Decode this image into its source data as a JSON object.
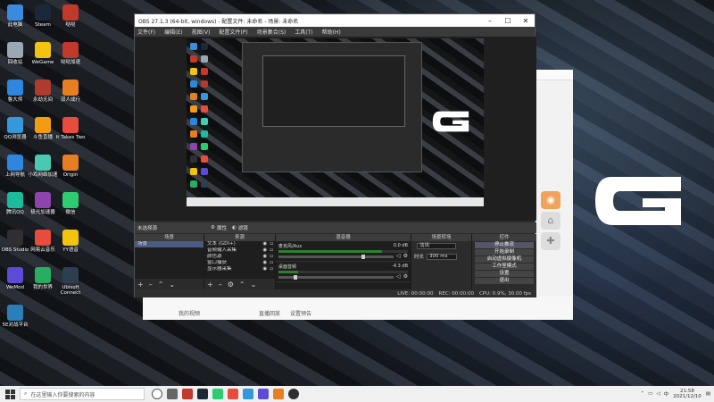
{
  "desktop_icons": [
    {
      "label": "此电脑",
      "color": "#3a8be0"
    },
    {
      "label": "Steam",
      "color": "#1b2838"
    },
    {
      "label": "哒哒",
      "color": "#c0392b"
    },
    {
      "label": "回收站",
      "color": "#9aa7b5"
    },
    {
      "label": "WeGame",
      "color": "#f1c40f"
    },
    {
      "label": "哒哒加速",
      "color": "#c0392b"
    },
    {
      "label": "鲁大师",
      "color": "#2e86de"
    },
    {
      "label": "永劫无间",
      "color": "#b03a2e"
    },
    {
      "label": "双人成行",
      "color": "#e67e22"
    },
    {
      "label": "QQ浏览器",
      "color": "#3498db"
    },
    {
      "label": "斗鱼直播",
      "color": "#f39c12"
    },
    {
      "label": "It Takes Two",
      "color": "#e74c3c"
    },
    {
      "label": "上网导航",
      "color": "#2e86de"
    },
    {
      "label": "小鸡网络加速",
      "color": "#48c9b0"
    },
    {
      "label": "Origin",
      "color": "#e67e22"
    },
    {
      "label": "腾讯QQ",
      "color": "#1abc9c"
    },
    {
      "label": "极光加速器",
      "color": "#8e44ad"
    },
    {
      "label": "微信",
      "color": "#2ecc71"
    },
    {
      "label": "OBS Studio",
      "color": "#302e31"
    },
    {
      "label": "网易云音乐",
      "color": "#e74c3c"
    },
    {
      "label": "YY语音",
      "color": "#f1c40f"
    },
    {
      "label": "WeMod",
      "color": "#5b4bd6"
    },
    {
      "label": "我的世界",
      "color": "#27ae60"
    },
    {
      "label": "Ubisoft Connect",
      "color": "#2c3e50"
    },
    {
      "label": "5E对战平台",
      "color": "#2980b9"
    }
  ],
  "obs": {
    "title": "OBS 27.1.3 (64-bit, windows) - 配置文件: 未命名 - 场景: 未命名",
    "menu": [
      "文件(F)",
      "编辑(E)",
      "视图(V)",
      "配置文件(P)",
      "场景集合(S)",
      "工具(T)",
      "帮助(H)"
    ],
    "mode_bar": {
      "label": "未选择源",
      "properties": "属性",
      "filters": "滤镜"
    },
    "docks": {
      "scenes": {
        "title": "场景",
        "items": [
          "场景"
        ]
      },
      "sources": {
        "title": "来源",
        "items": [
          "文本 (GDI+)",
          "音频输入采集",
          "颜色源",
          "窗口捕获",
          "显示器采集"
        ]
      },
      "mixer": {
        "title": "混音器",
        "channels": [
          {
            "name": "麦克风/Aux",
            "db": "0.0 dB",
            "level": 0.8
          },
          {
            "name": "桌面音频",
            "db": "-4.3 dB",
            "level": 0.15
          }
        ]
      },
      "transitions": {
        "title": "场景转场",
        "type": "淡出",
        "duration_label": "时长",
        "duration": "300 ms"
      },
      "controls": {
        "title": "控件",
        "buttons": [
          "停止推流",
          "开始录制",
          "启动虚拟摄像机",
          "工作室模式",
          "设置",
          "退出"
        ]
      }
    },
    "status": {
      "live": "LIVE: 00:00:00",
      "rec": "REC: 00:00:00",
      "cpu": "CPU: 0.9%, 30.00 fps"
    }
  },
  "background_app": {
    "item1": "我的视频",
    "item2": "直播回放",
    "item3": "设置预告"
  },
  "taskbar": {
    "search_placeholder": "在这里输入你要搜索的内容",
    "time": "21:58",
    "date": "2021/12/10",
    "ime": "中"
  }
}
